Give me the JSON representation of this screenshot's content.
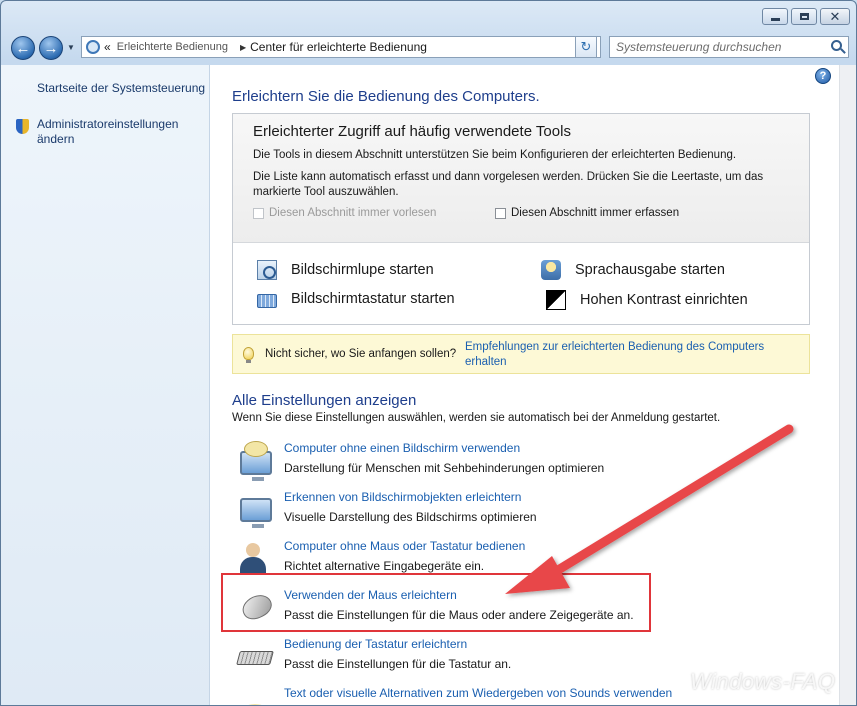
{
  "window": {
    "controls": {
      "minimize": "minimize",
      "maximize": "maximize",
      "close": "✕"
    }
  },
  "navbar": {
    "breadcrumb_prefix": "«",
    "breadcrumbs": [
      "Erleichterte Bedienung",
      "Center für erleichterte Bedienung"
    ],
    "search_placeholder": "Systemsteuerung durchsuchen"
  },
  "sidebar": {
    "home_link": "Startseite der Systemsteuerung",
    "admin_link": "Administratoreinstellungen ändern"
  },
  "main": {
    "help": "?",
    "title": "Erleichtern Sie die Bedienung des Computers.",
    "tools": {
      "heading": "Erleichterter Zugriff auf häufig verwendete Tools",
      "desc1": "Die Tools in diesem Abschnitt unterstützen Sie beim Konfigurieren der erleichterten Bedienung.",
      "desc2": "Die Liste kann automatisch erfasst und dann vorgelesen werden. Drücken Sie die Leertaste, um das markierte Tool auszuwählen.",
      "checkbox_read": "Diesen Abschnitt immer vorlesen",
      "checkbox_scan": "Diesen Abschnitt immer erfassen",
      "magnifier": "Bildschirmlupe starten",
      "narrator": "Sprachausgabe starten",
      "keyboard": "Bildschirmtastatur starten",
      "contrast": "Hohen Kontrast einrichten"
    },
    "hint": {
      "text": "Nicht sicher, wo Sie anfangen sollen?",
      "link": "Empfehlungen zur erleichterten Bedienung des Computers erhalten"
    },
    "section": {
      "title": "Alle Einstellungen anzeigen",
      "desc": "Wenn Sie diese Einstellungen auswählen, werden sie automatisch bei der Anmeldung gestartet."
    },
    "settings": [
      {
        "title": "Computer ohne einen Bildschirm verwenden",
        "desc": "Darstellung für Menschen mit Sehbehinderungen optimieren"
      },
      {
        "title": "Erkennen von Bildschirmobjekten erleichtern",
        "desc": "Visuelle Darstellung des Bildschirms optimieren"
      },
      {
        "title": "Computer ohne Maus oder Tastatur bedienen",
        "desc": "Richtet alternative Eingabegeräte ein."
      },
      {
        "title": "Verwenden der Maus erleichtern",
        "desc": "Passt die Einstellungen für die Maus oder andere Zeigegeräte an."
      },
      {
        "title": "Bedienung der Tastatur erleichtern",
        "desc": "Passt die Einstellungen für die Tastatur an."
      },
      {
        "title": "Text oder visuelle Alternativen zum Wiedergeben von Sounds verwenden",
        "desc": ""
      }
    ]
  },
  "annotation": {
    "color": "#e0353a"
  },
  "watermark": "Windows-FAQ"
}
